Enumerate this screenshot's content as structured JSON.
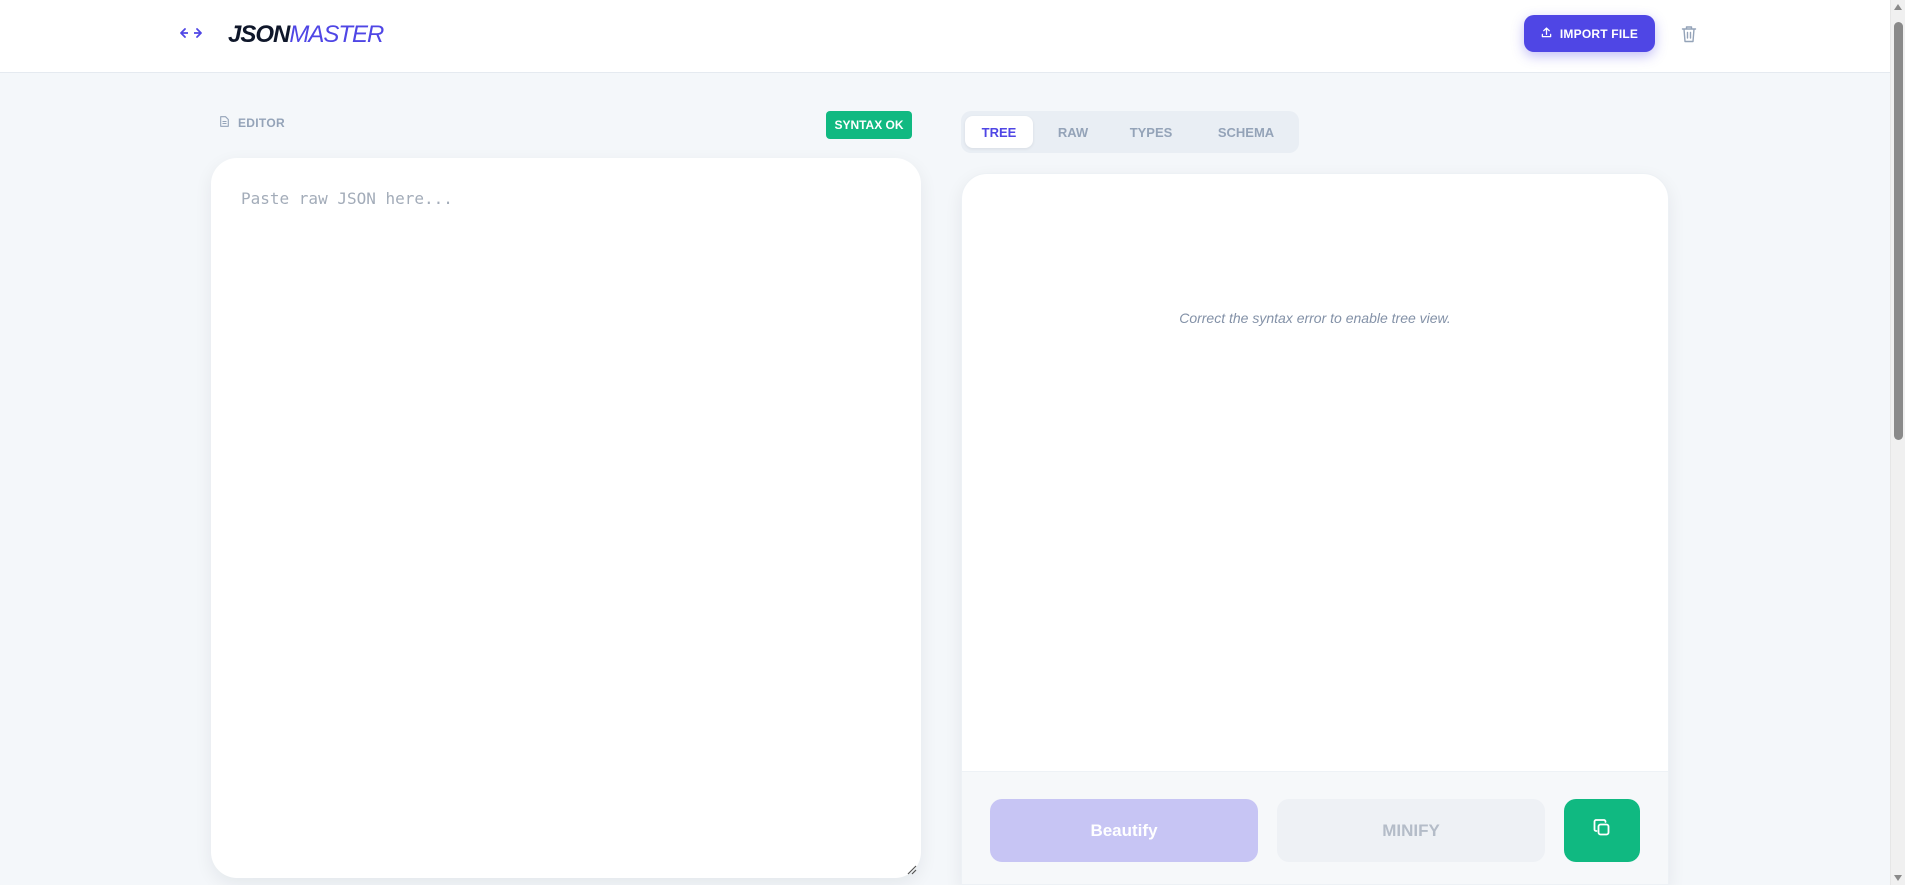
{
  "header": {
    "logo_strong": "JSON",
    "logo_light": "MASTER",
    "import_label": "IMPORT FILE",
    "icons": {
      "swap": "swap-arrows-icon",
      "upload": "upload-icon",
      "trash": "trash-icon"
    }
  },
  "editor": {
    "label": "EDITOR",
    "status_badge": "SYNTAX OK",
    "placeholder": "Paste raw JSON here...",
    "value": ""
  },
  "viewer": {
    "tabs": [
      {
        "label": "TREE",
        "active": true
      },
      {
        "label": "RAW",
        "active": false
      },
      {
        "label": "TYPES",
        "active": false
      },
      {
        "label": "SCHEMA",
        "active": false
      }
    ],
    "message": "Correct the syntax error to enable tree view.",
    "actions": {
      "beautify_label": "Beautify",
      "minify_label": "MINIFY",
      "copy_icon": "copy-icon"
    }
  },
  "colors": {
    "accent": "#4f46e5",
    "success": "#10b981",
    "background": "#f4f7fa"
  }
}
